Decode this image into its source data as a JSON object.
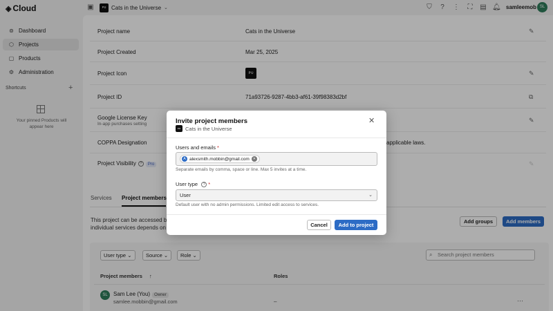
{
  "topbar": {
    "logo_text": "Cloud",
    "project_name": "Cats in the Universe",
    "project_badge": "ᴘᴜ",
    "username": "samleemob",
    "avatar_initials": "SL",
    "icons": [
      "sidebar-toggle-icon",
      "shield-icon",
      "help-icon",
      "apps-icon",
      "fullscreen-icon",
      "layout-icon",
      "bell-icon"
    ]
  },
  "sidebar": {
    "items": [
      {
        "label": "Dashboard",
        "icon": "dashboard-icon"
      },
      {
        "label": "Projects",
        "icon": "box-icon"
      },
      {
        "label": "Products",
        "icon": "products-icon"
      },
      {
        "label": "Administration",
        "icon": "gear-icon"
      }
    ],
    "shortcuts_label": "Shortcuts",
    "pinned_text": "Your pinned Products will appear here"
  },
  "project": {
    "rows": {
      "name_label": "Project name",
      "name_value": "Cats in the Universe",
      "created_label": "Project Created",
      "created_value": "Mar 25, 2025",
      "icon_label": "Project Icon",
      "id_label": "Project ID",
      "id_value": "71a93726-9287-4bb3-af61-39f98383d2bf",
      "license_label": "Google License Key",
      "license_sub": "In-app purchases setting",
      "coppa_label": "COPPA Designation",
      "coppa_value_tail": "applicable laws.",
      "visibility_label": "Project Visibility",
      "pro_badge": "Pro"
    }
  },
  "tabs": {
    "services": "Services",
    "members": "Project members"
  },
  "members_section": {
    "desc_line1": "This project can be accessed b",
    "desc_line2": "individual services depends on",
    "add_groups": "Add groups",
    "add_members": "Add members",
    "filters": [
      "User type",
      "Source",
      "Role"
    ],
    "search_placeholder": "Search project members",
    "col_members": "Project members",
    "col_roles": "Roles",
    "member": {
      "initials": "SL",
      "name": "Sam Lee (You)",
      "badge": "Owner",
      "email": "samlee.mobbin@gmail.com",
      "role": "–"
    }
  },
  "modal": {
    "title": "Invite project members",
    "project_name": "Cats in the Universe",
    "users_label": "Users and emails",
    "chip_initial": "A",
    "chip_email": "alexsmith.mobbin@gmail.com",
    "users_help": "Separate emails by comma, space or line. Max 5 invites at a time.",
    "user_type_label": "User type",
    "user_type_value": "User",
    "user_type_help": "Default user with no admin permissions. Limited edit access to services.",
    "cancel": "Cancel",
    "submit": "Add to project"
  },
  "colors": {
    "primary": "#2d6cc5",
    "avatar": "#2e7d5b",
    "required": "#c62828"
  }
}
